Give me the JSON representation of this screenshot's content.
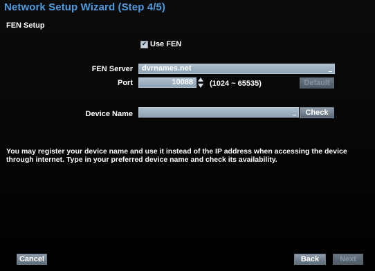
{
  "window": {
    "title": "Network Setup Wizard (Step 4/5)",
    "section": "FEN Setup"
  },
  "use_fen": {
    "label": "Use FEN",
    "checked": true
  },
  "fen_server": {
    "label": "FEN Server",
    "value": "dvrnames.net"
  },
  "port": {
    "label": "Port",
    "value": "10088",
    "range": "(1024 ~ 65535)",
    "default_label": "Default"
  },
  "device_name": {
    "label": "Device Name",
    "value": "",
    "check_label": "Check"
  },
  "info_text": "You may register your device name and use it instead of the IP address when accessing the device through internet. Type in your preferred device name and check its availability.",
  "footer": {
    "cancel_label": "Cancel",
    "back_label": "Back",
    "next_label": "Next"
  },
  "colors": {
    "title": "#4e9be0",
    "field": "#9fb2c4",
    "button": "#7a8894"
  }
}
